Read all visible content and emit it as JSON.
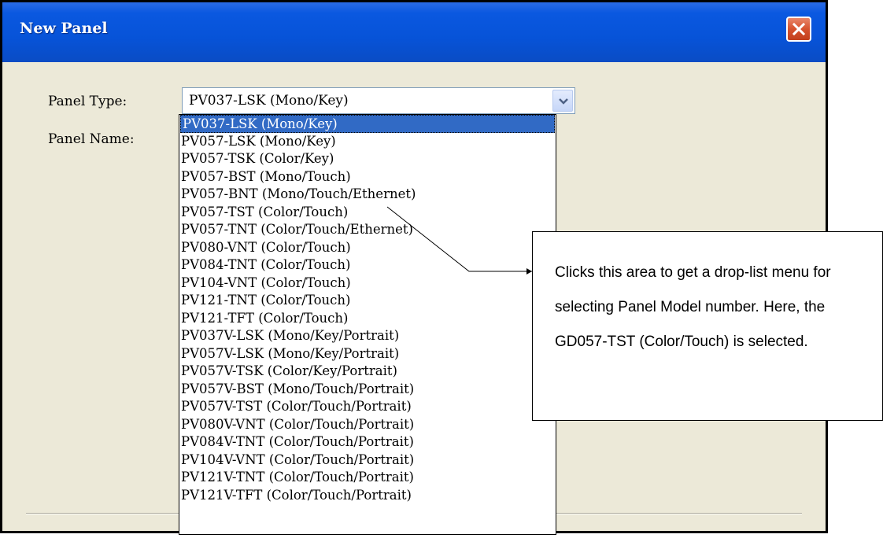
{
  "window": {
    "title": "New Panel",
    "close_icon": "close-icon"
  },
  "form": {
    "panel_type_label": "Panel Type:",
    "panel_name_label": "Panel Name:",
    "panel_type_value": "PV037-LSK (Mono/Key)"
  },
  "dropdown": {
    "selected_index": 0,
    "options": [
      "PV037-LSK (Mono/Key)",
      "PV057-LSK (Mono/Key)",
      "PV057-TSK (Color/Key)",
      "PV057-BST (Mono/Touch)",
      "PV057-BNT (Mono/Touch/Ethernet)",
      "PV057-TST (Color/Touch)",
      "PV057-TNT (Color/Touch/Ethernet)",
      "PV080-VNT (Color/Touch)",
      "PV084-TNT (Color/Touch)",
      "PV104-VNT (Color/Touch)",
      "PV121-TNT (Color/Touch)",
      "PV121-TFT (Color/Touch)",
      "PV037V-LSK (Mono/Key/Portrait)",
      "PV057V-LSK (Mono/Key/Portrait)",
      "PV057V-TSK (Color/Key/Portrait)",
      "PV057V-BST (Mono/Touch/Portrait)",
      "PV057V-TST (Color/Touch/Portrait)",
      "PV080V-VNT (Color/Touch/Portrait)",
      "PV084V-TNT (Color/Touch/Portrait)",
      "PV104V-VNT (Color/Touch/Portrait)",
      "PV121V-TNT (Color/Touch/Portrait)",
      "PV121V-TFT (Color/Touch/Portrait)"
    ]
  },
  "callout": {
    "text": "Clicks this area to get a drop-list menu for selecting Panel Model number. Here, the GD057-TST (Color/Touch) is selected."
  },
  "colors": {
    "titlebar": "#0753d8",
    "selection": "#316ac5",
    "window_bg": "#ece9d8",
    "close_button": "#d6522e"
  }
}
